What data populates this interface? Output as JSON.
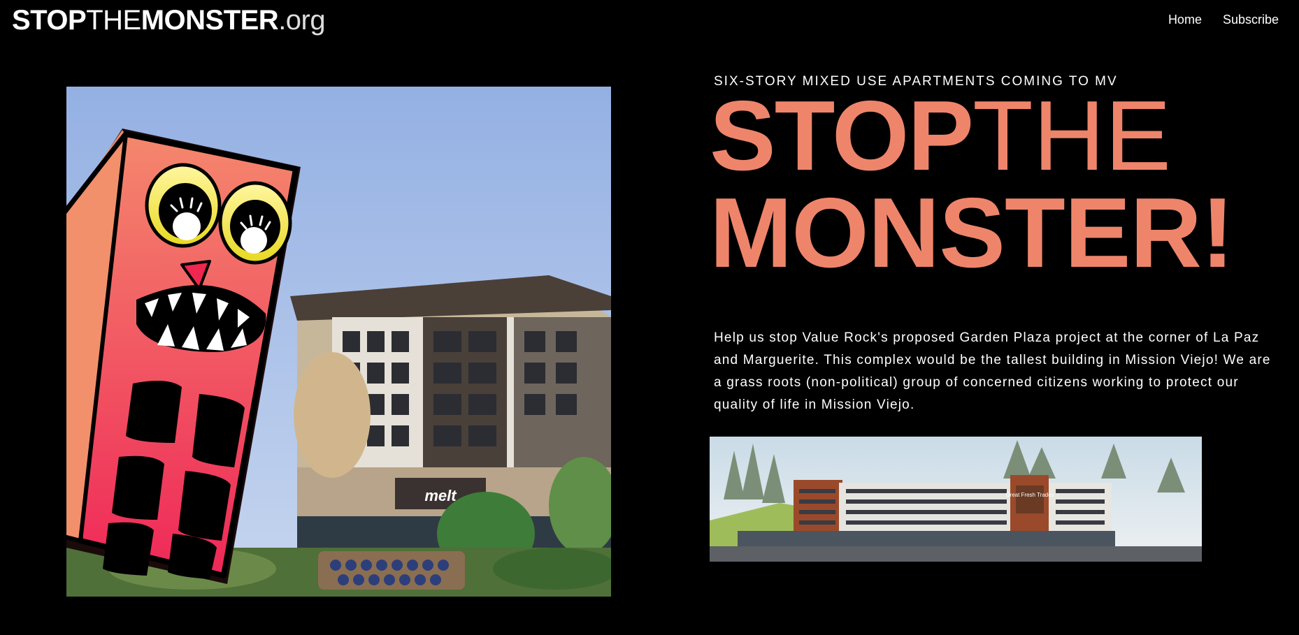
{
  "site": {
    "logo_stop": "STOP",
    "logo_the": "THE",
    "logo_monster": "MONSTER",
    "logo_org": ".org"
  },
  "nav": [
    {
      "label": "Home"
    },
    {
      "label": "Subscribe"
    }
  ],
  "hero": {
    "kicker": "SIX-STORY MIXED USE APARTMENTS COMING TO MV",
    "headline_stop": "STOP",
    "headline_the": "THE",
    "headline_monster": "MONSTER!",
    "description": "Help us stop Value Rock's proposed Garden Plaza project at the corner of La Paz and Marguerite.  This complex would be the tallest building in Mission Viejo! We are a grass roots (non-political) group of concerned citizens working to protect our quality of life in Mission Viejo."
  },
  "images": {
    "storefront_sign": "melt",
    "rendering_sign": "Great Fresh Trades"
  },
  "colors": {
    "background": "#000000",
    "accent": "#ee856b",
    "text": "#ffffff"
  },
  "icons": {
    "monster": "monster-building-cartoon"
  }
}
